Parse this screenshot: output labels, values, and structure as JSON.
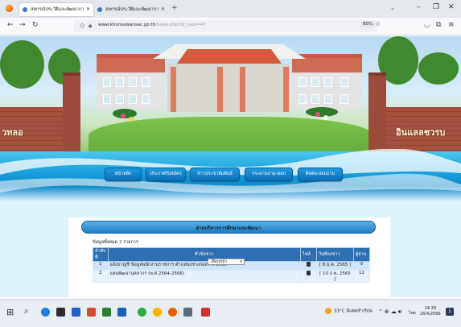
{
  "browser": {
    "tabs": [
      {
        "label": "สหกรณ์ประวัติและพัฒนาการ"
      },
      {
        "label": "สหกรณ์ประวัติและพัฒนาการ"
      }
    ],
    "url_host": "www.khonsawansac.go.th",
    "url_path": "/news.php?id_type=47",
    "zoom": "80%"
  },
  "site": {
    "left_sign": "วทลอ",
    "right_sign": "อินแลลชวรบ"
  },
  "menu": {
    "items": [
      {
        "label": "หน้าหลัก"
      },
      {
        "label": "ประกาศรับสมัคร"
      },
      {
        "label": "ข่าวประชาสัมพันธ์"
      },
      {
        "label": "กระดานถาม-ตอบ"
      },
      {
        "label": "ติดต่อ-สอบถาม"
      }
    ]
  },
  "panel": {
    "title": "ฝ่ายบริหารการศึกษาและพัฒนา",
    "count_prefix": "ข้อมูลทั้งหมด",
    "count_value": "2",
    "count_suffix": "รายการ",
    "columns": {
      "num": "ลำดับที่",
      "topic": "หัวข้อข่าว",
      "file": "ไฟล์",
      "date": "วันที่ลงข่าว",
      "views": "ผู้อ่าน"
    },
    "rows": [
      {
        "num": "1",
        "topic": "แจ้งบาญชี ข้อมูลพนักงานราชการ ตำแหน่งช่างก่อสร้าง 2565",
        "date": "[ 8 ม.ค. 2565 ]",
        "views": "0"
      },
      {
        "num": "2",
        "topic": "แผนพัฒนาบุคลากร (พ.ศ.2564-2566)",
        "date": "[ 10 ก.พ. 2565 ]",
        "views": "12"
      }
    ],
    "page_select": "เลือกหน้า"
  },
  "taskbar": {
    "weather": "33°C มีแดดจ้า/ร้อน",
    "lang": "ไทย",
    "time": "14:39",
    "date": "26/4/2566",
    "notifications": "1"
  },
  "colors": {
    "accent_blue": "#1a73c6",
    "menu_button": "#1f9be0",
    "table_header": "#2d6fb3"
  }
}
